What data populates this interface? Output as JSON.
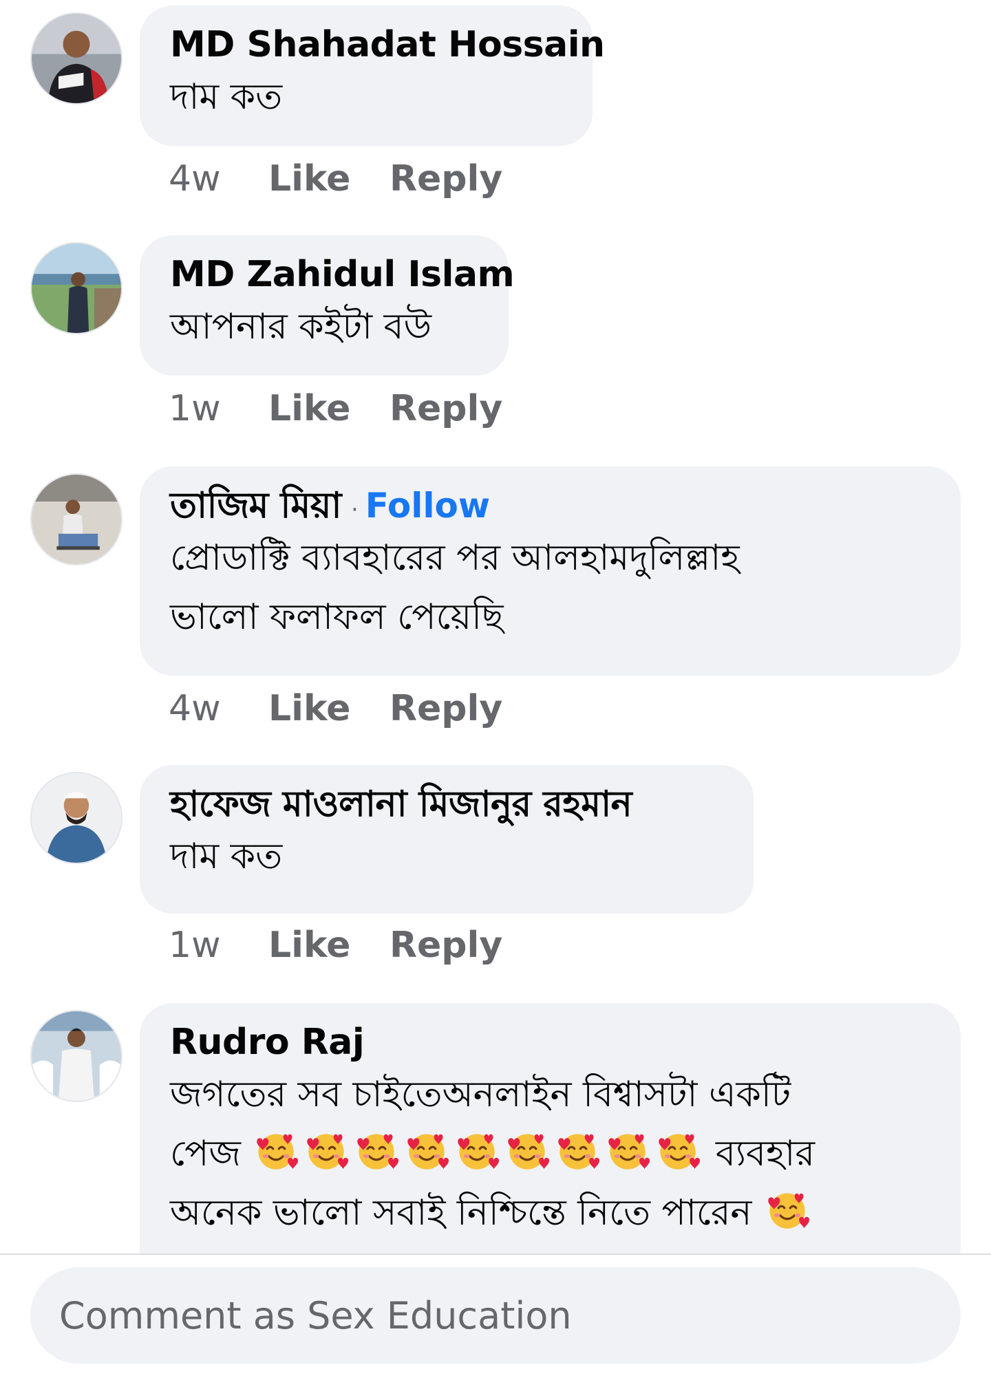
{
  "comments": [
    {
      "author": "MD Shahadat Hossain",
      "follow": "",
      "lines": [
        "দাম কত"
      ],
      "time": "4w",
      "like": "Like",
      "reply": "Reply"
    },
    {
      "author": "MD Zahidul Islam",
      "follow": "",
      "lines": [
        "আপনার কইটা বউ"
      ],
      "time": "1w",
      "like": "Like",
      "reply": "Reply"
    },
    {
      "author": "তাজিম মিয়া",
      "dot": "·",
      "follow": "Follow",
      "lines": [
        "প্রোডাক্টি ব্যাবহারের পর আলহামদুলিল্লাহ",
        "ভালো ফলাফল পেয়েছি"
      ],
      "time": "4w",
      "like": "Like",
      "reply": "Reply"
    },
    {
      "author": "হাফেজ মাওলানা মিজানুর রহমান",
      "follow": "",
      "lines": [
        "দাম কত"
      ],
      "time": "1w",
      "like": "Like",
      "reply": "Reply"
    },
    {
      "author": "Rudro Raj",
      "follow": "",
      "lines": [
        "জগতের সব চাইতেঅনলাইন বিশ্বাসটা একটি",
        "পেজ",
        "অনেক ভালো সবাই নিশ্চিন্তে নিতে পারেন"
      ],
      "line2_suffix": "ব্যবহার",
      "emoji_count_line2": 9,
      "emoji_count_line3": 1,
      "emoji_name": "smiling-face-with-hearts"
    }
  ],
  "composer": {
    "placeholder": "Comment as Sex Education"
  },
  "colors": {
    "bubble": "#f0f2f5",
    "follow": "#1877f2",
    "meta": "#65676b",
    "text": "#050505"
  }
}
